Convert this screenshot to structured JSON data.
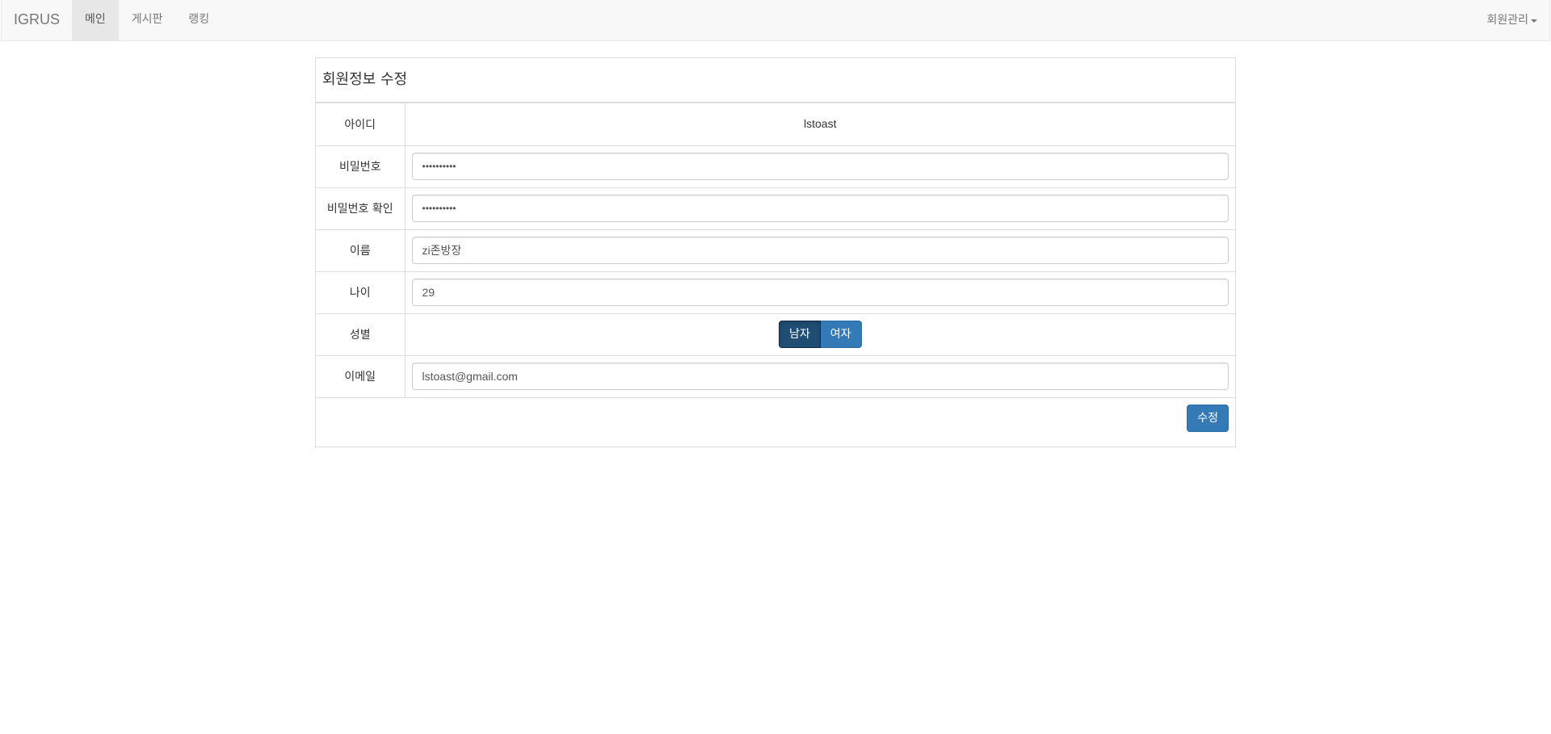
{
  "navbar": {
    "brand": "IGRUS",
    "items": [
      {
        "label": "메인",
        "active": true
      },
      {
        "label": "게시판",
        "active": false
      },
      {
        "label": "랭킹",
        "active": false
      }
    ],
    "member_menu": "회원관리"
  },
  "panel": {
    "title": "회원정보 수정",
    "fields": {
      "id": {
        "label": "아이디",
        "value": "lstoast"
      },
      "password": {
        "label": "비밀번호",
        "value": "••••••••••"
      },
      "password_confirm": {
        "label": "비밀번호 확인",
        "value": "••••••••••"
      },
      "name": {
        "label": "이름",
        "value": "zi존방장"
      },
      "age": {
        "label": "나이",
        "value": "29"
      },
      "gender": {
        "label": "성별",
        "options": [
          "남자",
          "여자"
        ],
        "selected": "남자"
      },
      "email": {
        "label": "이메일",
        "value": "lstoast@gmail.com"
      }
    },
    "submit_label": "수정"
  },
  "colors": {
    "primary": "#337ab7",
    "primary_active": "#204d74",
    "navbar_bg": "#f8f8f8"
  }
}
